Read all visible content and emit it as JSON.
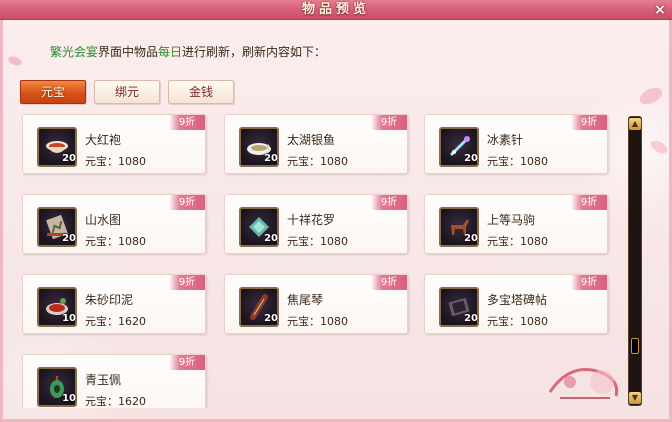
{
  "window": {
    "title": "物品预览",
    "close_label": "×"
  },
  "intro": {
    "part1": "繁光会宴",
    "part2": "界面中物品",
    "part3": "每日",
    "part4": "进行刷新，刷新内容如下："
  },
  "tabs": [
    {
      "label": "元宝",
      "active": true
    },
    {
      "label": "绑元",
      "active": false
    },
    {
      "label": "金钱",
      "active": false
    }
  ],
  "items": [
    {
      "name": "大红袍",
      "currency": "元宝：",
      "price": "1080",
      "qty": "20",
      "discount": "9折",
      "icon": "tea-bowl-icon"
    },
    {
      "name": "太湖银鱼",
      "currency": "元宝：",
      "price": "1080",
      "qty": "20",
      "discount": "9折",
      "icon": "fish-dish-icon"
    },
    {
      "name": "冰素针",
      "currency": "元宝：",
      "price": "1080",
      "qty": "20",
      "discount": "9折",
      "icon": "ice-needle-icon"
    },
    {
      "name": "山水图",
      "currency": "元宝：",
      "price": "1080",
      "qty": "20",
      "discount": "9折",
      "icon": "scroll-painting-icon"
    },
    {
      "name": "十祥花罗",
      "currency": "元宝：",
      "price": "1080",
      "qty": "20",
      "discount": "9折",
      "icon": "silk-cloth-icon"
    },
    {
      "name": "上等马驹",
      "currency": "元宝：",
      "price": "1080",
      "qty": "20",
      "discount": "9折",
      "icon": "horse-icon"
    },
    {
      "name": "朱砂印泥",
      "currency": "元宝：",
      "price": "1620",
      "qty": "10",
      "discount": "9折",
      "icon": "ink-pad-icon"
    },
    {
      "name": "焦尾琴",
      "currency": "元宝：",
      "price": "1080",
      "qty": "20",
      "discount": "9折",
      "icon": "guqin-icon"
    },
    {
      "name": "多宝塔碑帖",
      "currency": "元宝：",
      "price": "1080",
      "qty": "20",
      "discount": "9折",
      "icon": "rubbing-book-icon"
    },
    {
      "name": "青玉佩",
      "currency": "元宝：",
      "price": "1620",
      "qty": "10",
      "discount": "9折",
      "icon": "jade-pendant-icon"
    }
  ],
  "scrollbar": {
    "position": 0.85
  },
  "colors": {
    "title_bar": "#d65c76",
    "active_tab": "#d9521c",
    "highlight_text": "#2f8a2f",
    "discount_badge": "#d9607f"
  }
}
